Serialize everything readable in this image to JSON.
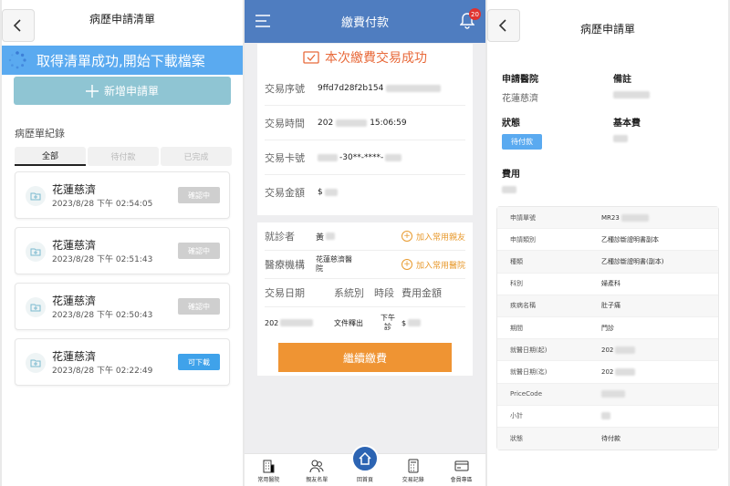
{
  "panel1": {
    "title": "病歷申請清單",
    "banner": "取得清單成功,開始下載檔案",
    "new_button": "新增申請單",
    "section_title": "病歷單紀錄",
    "tabs": [
      "全部",
      "待付款",
      "已完成"
    ],
    "records": [
      {
        "name": "花蓮慈濟",
        "date": "2023/8/28 下午 02:54:05",
        "status": "確認中"
      },
      {
        "name": "花蓮慈濟",
        "date": "2023/8/28 下午 02:51:43",
        "status": "確認中"
      },
      {
        "name": "花蓮慈濟",
        "date": "2023/8/28 下午 02:50:43",
        "status": "確認中"
      },
      {
        "name": "花蓮慈濟",
        "date": "2023/8/28 下午 02:22:49",
        "status": "可下載"
      }
    ]
  },
  "panel2": {
    "title": "繳費付款",
    "badge": "20",
    "success": "本次繳費交易成功",
    "rows": [
      {
        "key": "交易序號",
        "value": "9ffd7d28f2b154"
      },
      {
        "key": "交易時間",
        "value_a": "202",
        "value_b": "15:06:59"
      },
      {
        "key": "交易卡號",
        "value": "-30**-****-"
      },
      {
        "key": "交易金額",
        "value": "$"
      }
    ],
    "patient_label": "就診者",
    "patient_value": "黃",
    "patient_link": "加入常用親友",
    "hospital_label": "醫療機構",
    "hospital_value": "花蓮慈濟醫院",
    "hospital_link": "加入常用醫院",
    "heads": [
      "交易日期",
      "系統別",
      "時段",
      "費用金額"
    ],
    "vals": [
      "202",
      "文件釋出",
      "下午診",
      "$"
    ],
    "pay_button": "繼續繳費",
    "footer": [
      "常用醫院",
      "親友名單",
      "回首頁",
      "交易記錄",
      "會員專區"
    ]
  },
  "panel3": {
    "title": "病歷申請單",
    "hospital_label": "申請醫院",
    "hospital_value": "花蓮慈濟",
    "remark_label": "備註",
    "status_label": "狀態",
    "status_value": "待付款",
    "basefee_label": "基本費",
    "fee_label": "費用",
    "table": [
      {
        "k": "申請單號",
        "v": "MR23"
      },
      {
        "k": "申請類別",
        "v": "乙種診斷證明書副本"
      },
      {
        "k": "種類",
        "v": "乙種診斷證明書(副本)"
      },
      {
        "k": "科別",
        "v": "婦產科"
      },
      {
        "k": "疾病名稱",
        "v": "肚子痛"
      },
      {
        "k": "期間",
        "v": "門診"
      },
      {
        "k": "就醫日期(起)",
        "v": "202"
      },
      {
        "k": "就醫日期(迄)",
        "v": "202"
      },
      {
        "k": "PriceCode",
        "v": ""
      },
      {
        "k": "小計",
        "v": ""
      },
      {
        "k": "狀態",
        "v": "待付款"
      }
    ]
  }
}
